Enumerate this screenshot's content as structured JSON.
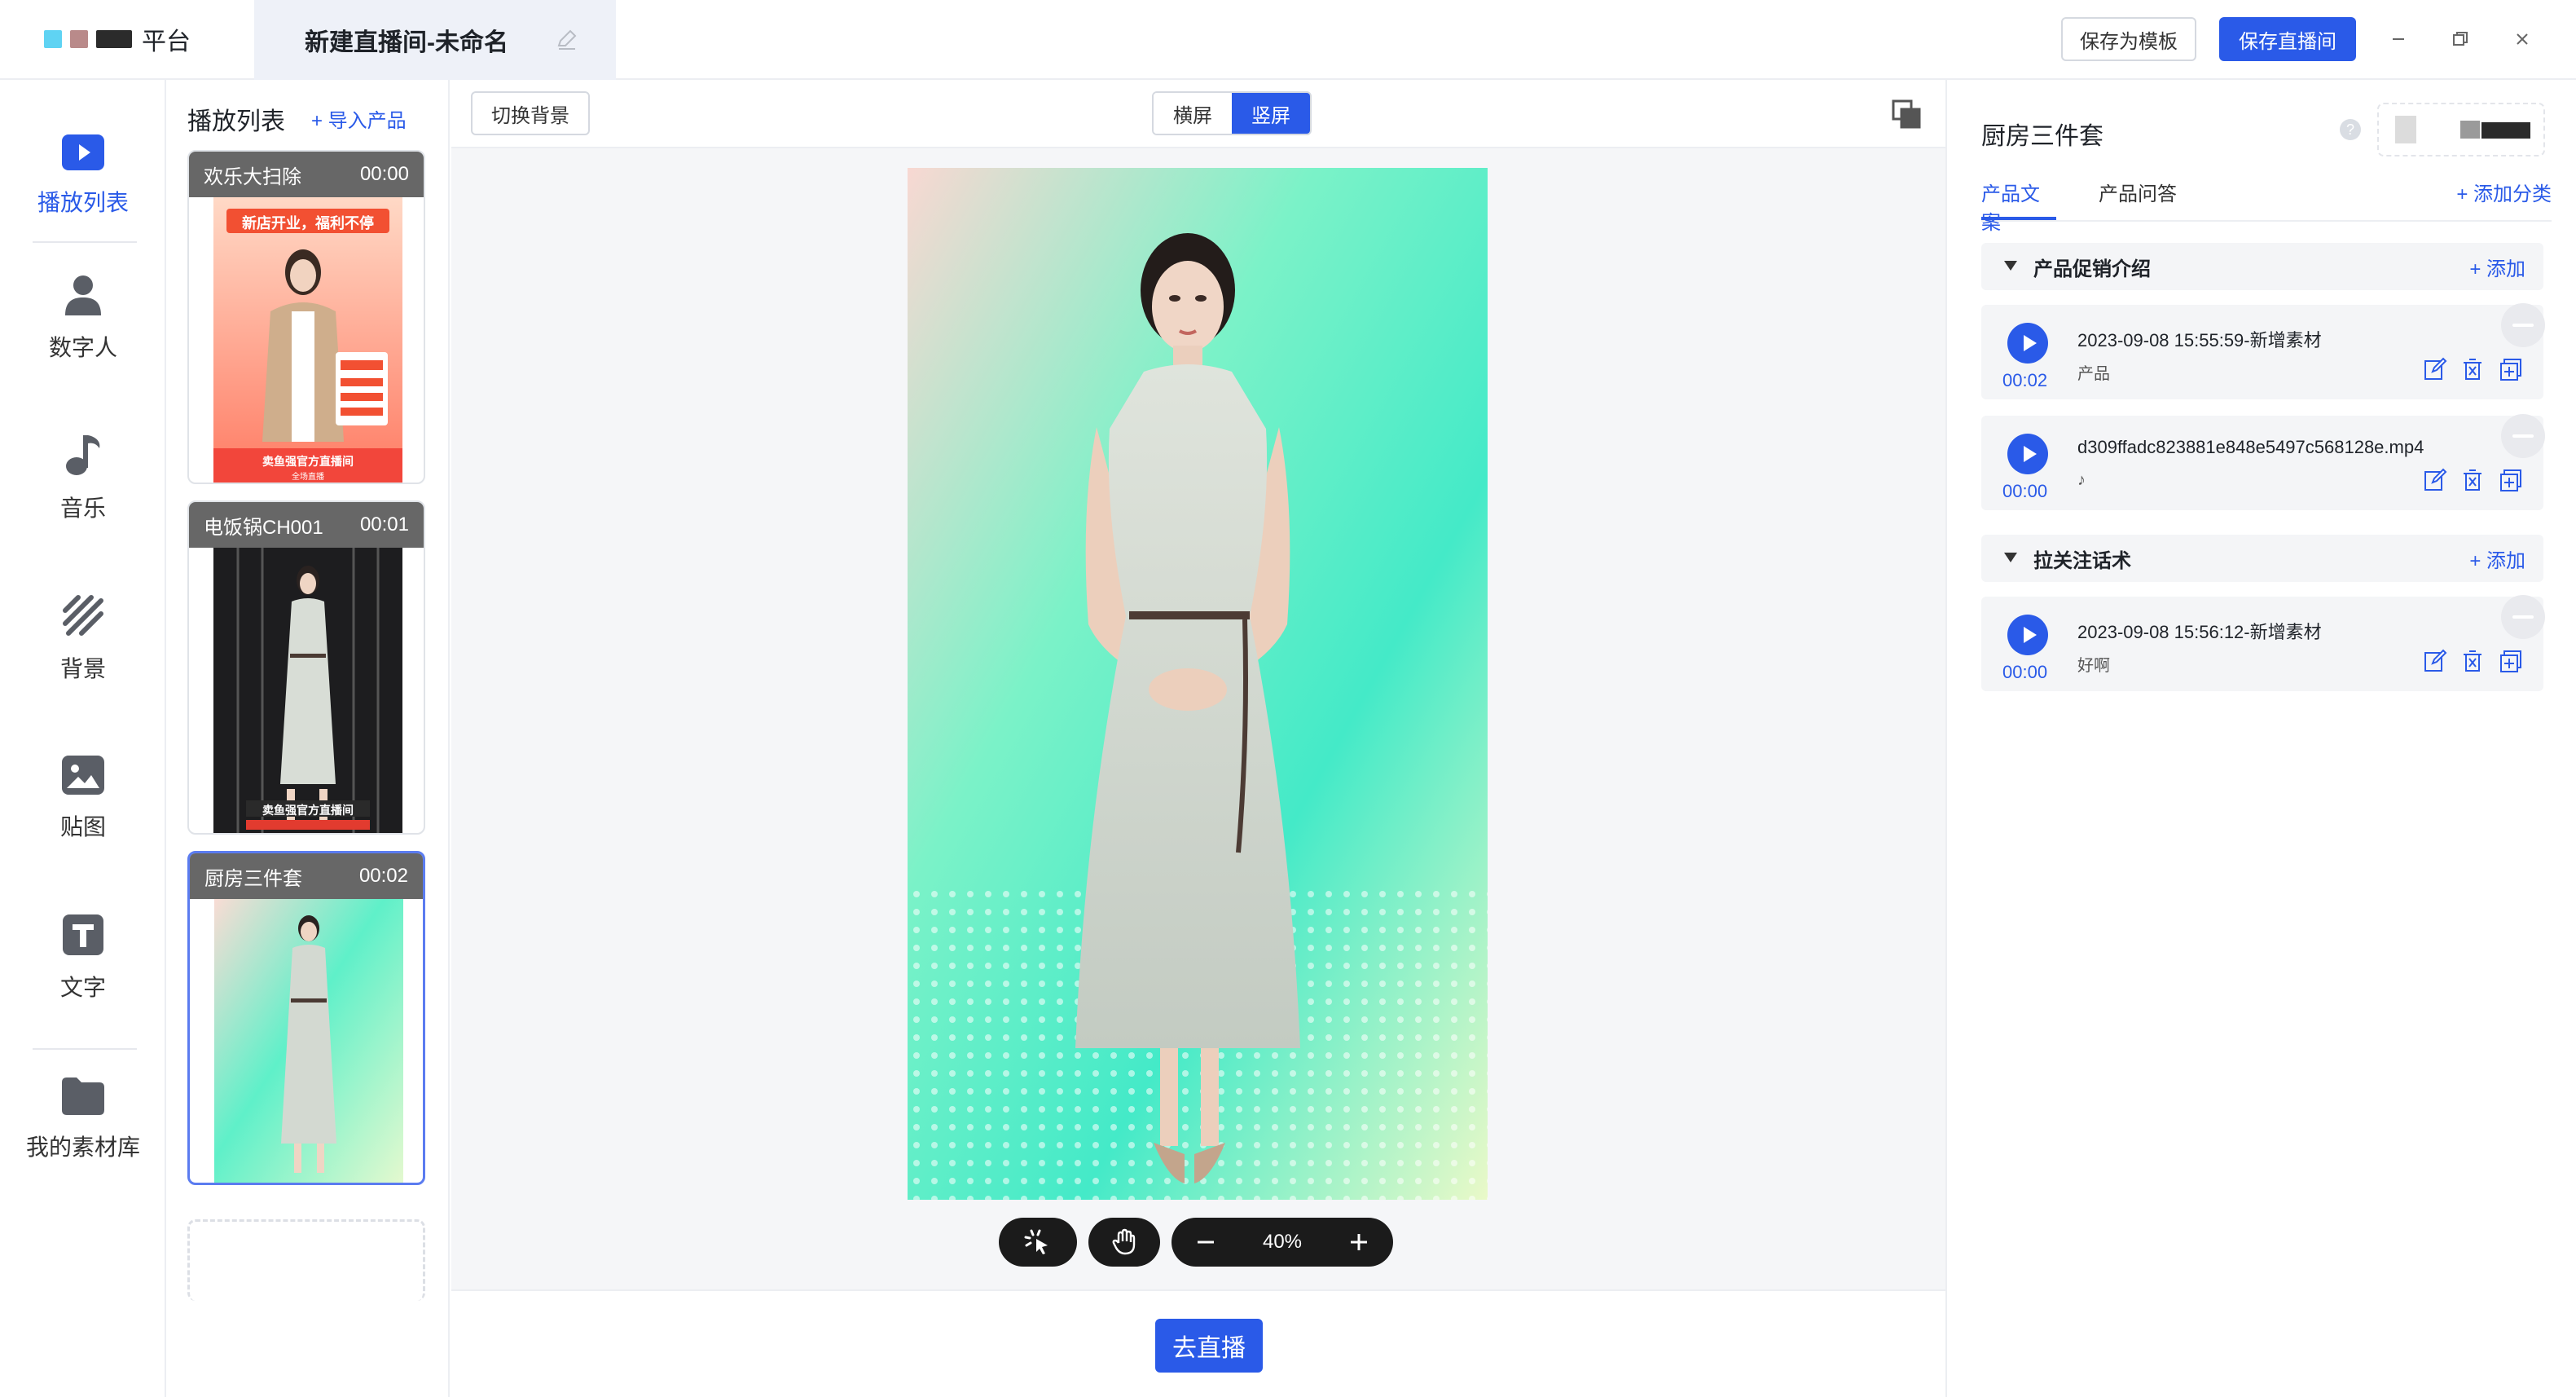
{
  "app": {
    "logo_text": "平台",
    "logo_colors": [
      "#5fd3f3",
      "#b98a8a",
      "#2b2b2b"
    ],
    "doc_title": "新建直播间-未命名",
    "save_template_label": "保存为模板",
    "save_room_label": "保存直播间"
  },
  "leftnav": {
    "items": [
      {
        "label": "播放列表",
        "icon": "play-list-icon",
        "active": true
      },
      {
        "label": "数字人",
        "icon": "person-icon"
      },
      {
        "label": "音乐",
        "icon": "music-icon"
      },
      {
        "label": "背景",
        "icon": "background-icon"
      },
      {
        "label": "贴图",
        "icon": "sticker-icon"
      },
      {
        "label": "文字",
        "icon": "text-icon"
      },
      {
        "label": "我的素材库",
        "icon": "folder-icon"
      }
    ]
  },
  "playlist": {
    "title": "播放列表",
    "import_label": "+ 导入产品",
    "cards": [
      {
        "name": "欢乐大扫除",
        "time": "00:00",
        "banner": "新店开业，福利不停",
        "footer": "卖鱼强官方直播间",
        "sub_banner": "全场直播"
      },
      {
        "name": "电饭锅CH001",
        "time": "00:01",
        "footer": "卖鱼强官方直播间"
      },
      {
        "name": "厨房三件套",
        "time": "00:02",
        "active": true
      }
    ]
  },
  "canvas": {
    "switch_bg_label": "切换背景",
    "orientation": {
      "landscape": "横屏",
      "portrait": "竖屏",
      "selected": "portrait"
    },
    "zoom": "40%",
    "go_live_label": "去直播"
  },
  "rpanel": {
    "title": "厨房三件套",
    "help": "?",
    "tabs": [
      {
        "label": "产品文案",
        "active": true
      },
      {
        "label": "产品问答"
      }
    ],
    "add_category": "+ 添加分类",
    "groups": [
      {
        "title": "产品促销介绍",
        "add_label": "+ 添加",
        "items": [
          {
            "duration": "00:02",
            "name": "2023-09-08 15:55:59-新增素材",
            "sub": "产品"
          },
          {
            "duration": "00:00",
            "name": "d309ffadc823881e848e5497c568128e.mp4",
            "sub": "♪"
          }
        ]
      },
      {
        "title": "拉关注话术",
        "add_label": "+ 添加",
        "items": [
          {
            "duration": "00:00",
            "name": "2023-09-08 15:56:12-新增素材",
            "sub": "好啊"
          }
        ]
      }
    ]
  },
  "colors": {
    "accent": "#2a5ae8",
    "panel_bg": "#f4f5f7"
  }
}
